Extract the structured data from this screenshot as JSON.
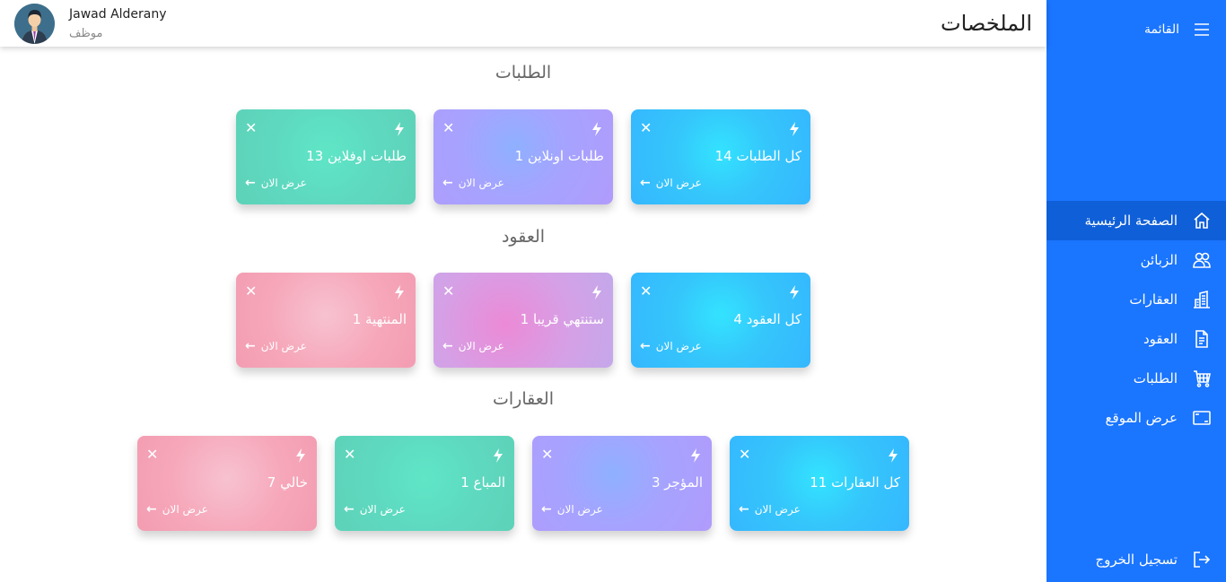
{
  "header": {
    "title": "الملخصات",
    "user_name": "Jawad Alderany",
    "user_role": "موظف"
  },
  "sidebar": {
    "menu_label": "القائمة",
    "items": [
      {
        "label": "الصفحة الرئيسية",
        "icon": "home-icon",
        "active": true
      },
      {
        "label": "الزبائن",
        "icon": "users-icon"
      },
      {
        "label": "العقارات",
        "icon": "building-icon"
      },
      {
        "label": "العقود",
        "icon": "document-icon"
      },
      {
        "label": "الطلبات",
        "icon": "cart-icon"
      },
      {
        "label": "عرض الموقع",
        "icon": "monitor-icon"
      }
    ],
    "logout_label": "تسجيل الخروج"
  },
  "sections": [
    {
      "title": "الطلبات",
      "cards": [
        {
          "title": "كل الطلبات 14",
          "link": "عرض الان",
          "color": "#35c6fb"
        },
        {
          "title": "طلبات اونلاين 1",
          "link": "عرض الان",
          "color": "#a6a3ff"
        },
        {
          "title": "طلبات اوفلاين 13",
          "link": "عرض الان",
          "color": "#5ed9c0"
        }
      ]
    },
    {
      "title": "العقود",
      "cards": [
        {
          "title": "كل العقود 4",
          "link": "عرض الان",
          "color": "#35c6fb"
        },
        {
          "title": "ستنتهي قريبا 1",
          "link": "عرض الان",
          "color": "#d5a0e6"
        },
        {
          "title": "المنتهية 1",
          "link": "عرض الان",
          "color": "#f6a7b9"
        }
      ]
    },
    {
      "title": "العقارات",
      "cards": [
        {
          "title": "كل العقارات 11",
          "link": "عرض الان",
          "color": "#35c6fb"
        },
        {
          "title": "المؤجر 3",
          "link": "عرض الان",
          "color": "#a6a3ff"
        },
        {
          "title": "المباع 1",
          "link": "عرض الان",
          "color": "#5ed9c0"
        },
        {
          "title": "خالي 7",
          "link": "عرض الان",
          "color": "#f6a7b9"
        }
      ]
    }
  ],
  "colors": {
    "sidebar": "#1a75ff",
    "sidebar_active": "#0f5fd8"
  }
}
